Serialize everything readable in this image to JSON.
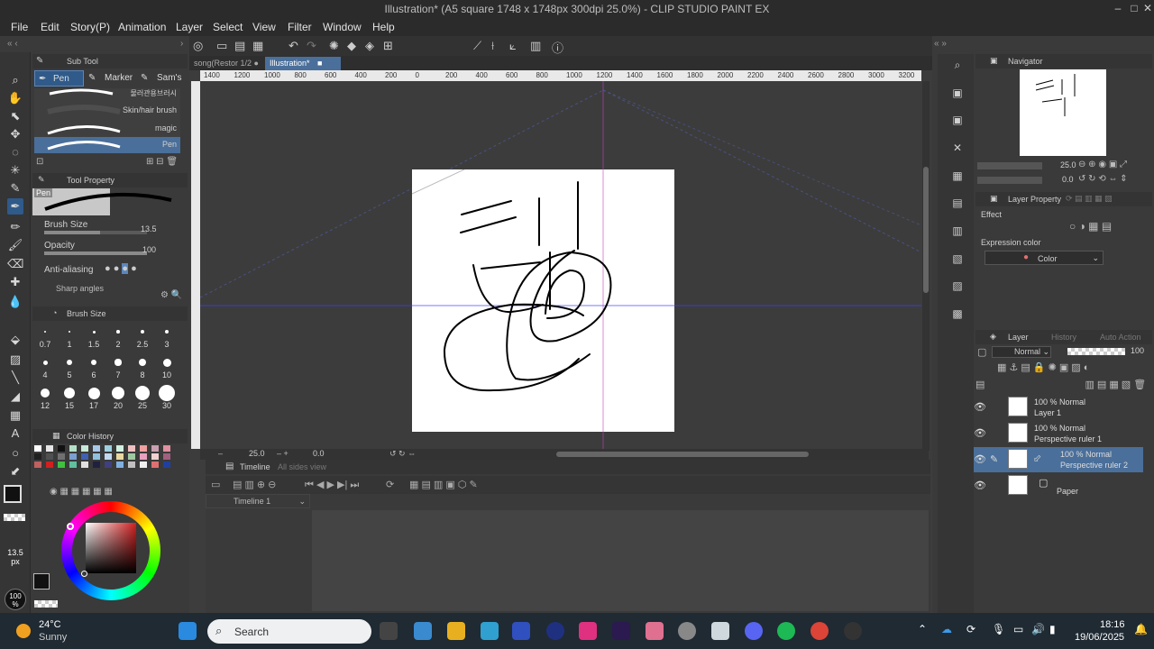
{
  "window": {
    "title": "Illustration* (A5 square 1748 x 1748px 300dpi 25.0%) - CLIP STUDIO PAINT EX",
    "controls": [
      "–",
      "□",
      "✕"
    ]
  },
  "menu": [
    "File",
    "Edit",
    "Story(P)",
    "Animation",
    "Layer",
    "Select",
    "View",
    "Filter",
    "Window",
    "Help"
  ],
  "doc_tabs": [
    {
      "label": "song(Restor 1/2"
    },
    {
      "label": "Illustration*"
    }
  ],
  "ruler_ticks": [
    "1400",
    "1200",
    "1000",
    "800",
    "600",
    "400",
    "200",
    "0",
    "200",
    "400",
    "600",
    "800",
    "1000",
    "1200",
    "1400",
    "1600",
    "1800",
    "2000",
    "2200",
    "2400",
    "2600",
    "2800",
    "3000",
    "3200"
  ],
  "sub_tool": {
    "header": "Sub Tool",
    "tabs": [
      "Pen",
      "Marker",
      "Sam's F"
    ],
    "brushes": [
      "물러관용브러시",
      "Skin/hair brush",
      "magic",
      "Pen"
    ]
  },
  "tool_property": {
    "header": "Tool Property",
    "preview_label": "Pen",
    "brush_size_label": "Brush Size",
    "brush_size_value": "13.5",
    "opacity_label": "Opacity",
    "opacity_value": "100",
    "antialiasing_label": "Anti-aliasing",
    "sharp_label": "Sharp angles"
  },
  "brush_size_palette": {
    "header": "Brush Size",
    "sizes": [
      "0.7",
      "1",
      "1.5",
      "2",
      "2.5",
      "3",
      "4",
      "5",
      "6",
      "7",
      "8",
      "10",
      "12",
      "15",
      "17",
      "20",
      "25",
      "30"
    ]
  },
  "color_history": {
    "header": "Color History"
  },
  "color_swatches": [
    "#ffffff",
    "#e6e6e6",
    "#111111",
    "#b4e0c8",
    "#c8e8d8",
    "#a8c8e8",
    "#9ed0e0",
    "#d0f0e0",
    "#f0c0c0",
    "#f0a0a0",
    "#c8a0b0",
    "#e090a0",
    "#202020",
    "#505050",
    "#707070",
    "#7aa0d0",
    "#4060b0",
    "#90c0e0",
    "#c0d8f0",
    "#e8d8a0",
    "#a0c8a0",
    "#e8a0c0",
    "#f0d0d0",
    "#a06080",
    "#c06060",
    "#d02020",
    "#40c040",
    "#60c0a0",
    "#e0e0e0",
    "#202040",
    "#404080",
    "#80b0e0",
    "#c0c0c0",
    "#f0f0f0",
    "#e07070",
    "#2040a0"
  ],
  "status_bar": {
    "zoom": "25.0",
    "angle": "0.0"
  },
  "timeline": {
    "header": "Timeline",
    "sub": "All sides view",
    "track": "Timeline 1"
  },
  "navigator": {
    "header": "Navigator",
    "zoom": "25.0",
    "angle": "0.0"
  },
  "layer_property": {
    "header": "Layer Property",
    "effect_label": "Effect",
    "expression_label": "Expression color",
    "expression_value": "Color"
  },
  "layers_panel": {
    "tabs": [
      "Layer",
      "History",
      "Auto Action"
    ],
    "blend": "Normal",
    "opacity": "100"
  },
  "layers": [
    {
      "mode": "100 % Normal",
      "name": "Layer 1"
    },
    {
      "mode": "100 % Normal",
      "name": "Perspective ruler 1"
    },
    {
      "mode": "100 % Normal",
      "name": "Perspective ruler 2"
    },
    {
      "mode": "",
      "name": "Paper"
    }
  ],
  "size_indicator": {
    "value": "13.5",
    "unit": "px"
  },
  "opacity_indicator": {
    "value": "100",
    "unit": "%"
  },
  "colors": {
    "accent": "#2f5a8a",
    "selected_layer": "#4a6f9a",
    "taskbar": "#1f2a33"
  },
  "taskbar": {
    "weather_temp": "24°C",
    "weather_desc": "Sunny",
    "search_placeholder": "Search",
    "time": "18:16",
    "date": "19/06/2025"
  }
}
